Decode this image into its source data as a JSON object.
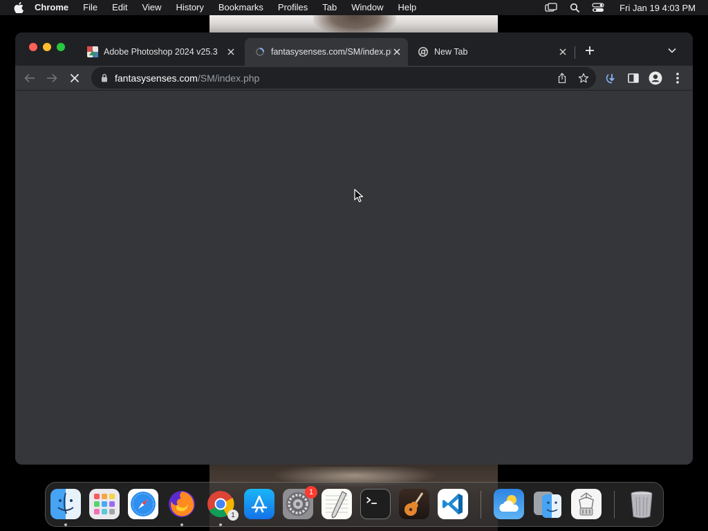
{
  "menubar": {
    "apple_icon": "apple-logo-icon",
    "items": [
      "Chrome",
      "File",
      "Edit",
      "View",
      "History",
      "Bookmarks",
      "Profiles",
      "Tab",
      "Window",
      "Help"
    ],
    "status_icons": [
      "screen-mirroring-icon",
      "spotlight-search-icon",
      "control-center-icon"
    ],
    "clock": "Fri Jan 19  4:03 PM"
  },
  "browser": {
    "tabs": [
      {
        "title": "Adobe Photoshop 2024 v25.3",
        "favicon": "photoshop-favicon-icon",
        "active": false
      },
      {
        "title": "fantasysenses.com/SM/index.php",
        "favicon": "loading-spinner-icon",
        "active": true
      },
      {
        "title": "New Tab",
        "favicon": "chrome-favicon-icon",
        "active": false
      }
    ],
    "address": {
      "host": "fantasysenses.com",
      "path": "/SM/index.php"
    },
    "colors": {
      "frame": "#202124",
      "toolbar": "#35363a",
      "omnibox": "#202124",
      "download_accent": "#8ab4f8"
    }
  },
  "dock": {
    "apps": [
      "Finder",
      "Launchpad",
      "Safari",
      "Firefox",
      "Google Chrome",
      "App Store",
      "System Settings",
      "TextEdit",
      "Terminal",
      "GarageBand",
      "Visual Studio Code",
      "Weather",
      "Migration Assistant",
      "Archive Utility",
      "Trash"
    ],
    "badges": {
      "system_settings": "1",
      "chrome": "1"
    }
  }
}
